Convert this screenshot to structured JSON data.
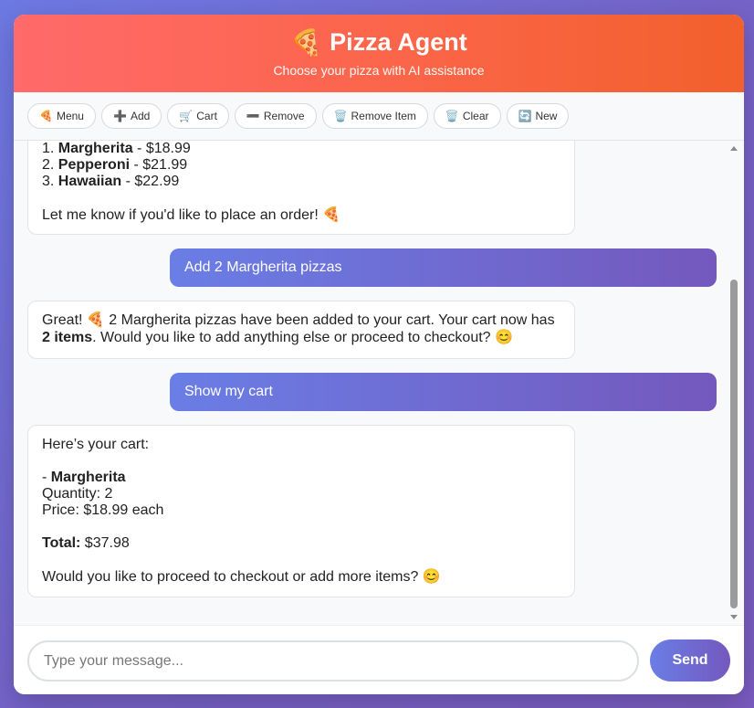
{
  "header": {
    "title_emoji": "🍕",
    "title": "Pizza Agent",
    "subtitle": "Choose your pizza with AI assistance"
  },
  "toolbar": {
    "buttons": [
      {
        "icon": "🍕",
        "label": "Menu"
      },
      {
        "icon": "➕",
        "label": "Add"
      },
      {
        "icon": "🛒",
        "label": "Cart"
      },
      {
        "icon": "➖",
        "label": "Remove"
      },
      {
        "icon": "🗑️",
        "label": "Remove Item"
      },
      {
        "icon": "🗑️",
        "label": "Clear"
      },
      {
        "icon": "🔄",
        "label": "New"
      }
    ]
  },
  "messages": {
    "bot1": {
      "items": [
        {
          "num": "1.",
          "name": "Margherita",
          "price": " - $18.99"
        },
        {
          "num": "2.",
          "name": "Pepperoni",
          "price": " - $21.99"
        },
        {
          "num": "3.",
          "name": "Hawaiian",
          "price": " - $22.99"
        }
      ],
      "closing": "Let me know if you'd like to place an order! 🍕"
    },
    "user1": "Add 2 Margherita pizzas",
    "bot2": {
      "line1": "Great! 🍕 2 Margherita pizzas have been added to your cart. Your cart now has",
      "line2_bold": "2 items",
      "line2_rest": ". Would you like to add anything else or proceed to checkout? 😊"
    },
    "user2": "Show my cart",
    "bot3": {
      "intro": "Here’s your cart:",
      "item_prefix": "- ",
      "item_name": "Margherita",
      "quantity": "Quantity: 2",
      "price": "Price: $18.99 each",
      "total_label": "Total:",
      "total_value": " $37.98",
      "closing": "Would you like to proceed to checkout or add more items? 😊"
    }
  },
  "composer": {
    "placeholder": "Type your message...",
    "send_label": "Send"
  },
  "colors": {
    "header_gradient_start": "#ff6a6a",
    "header_gradient_end": "#f2602c",
    "accent_gradient_start": "#6a7ee6",
    "accent_gradient_end": "#7458bd"
  }
}
